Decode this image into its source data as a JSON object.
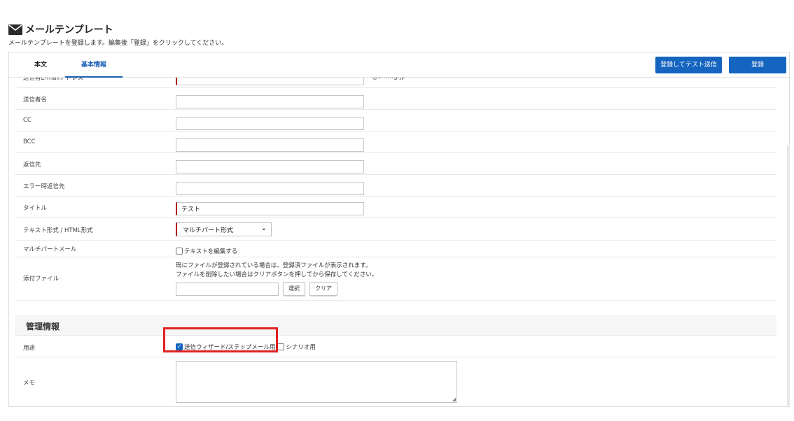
{
  "header": {
    "title": "メールテンプレート",
    "description": "メールテンプレートを登録します。編集後「登録」をクリックしてください。"
  },
  "tabs": [
    {
      "label": "本文"
    },
    {
      "label": "基本情報"
    }
  ],
  "toolbar": {
    "test_send_label": "登録してテスト送信",
    "save_label": "登録"
  },
  "form": {
    "sender_email": {
      "label": "送信者E-mailアドレス",
      "value": "",
      "domain": "@smktg.jp"
    },
    "sender_name": {
      "label": "送信者名",
      "value": ""
    },
    "cc": {
      "label": "CC",
      "value": ""
    },
    "bcc": {
      "label": "BCC",
      "value": ""
    },
    "reply_to": {
      "label": "返信先",
      "value": ""
    },
    "error_reply": {
      "label": "エラー時返信先",
      "value": ""
    },
    "title": {
      "label": "タイトル",
      "value": "テスト"
    },
    "format": {
      "label": "テキスト形式 / HTML形式",
      "selected": "マルチパート形式"
    },
    "multipart": {
      "label": "マルチパートメール",
      "checkbox_label": "テキストを編集する"
    },
    "attachment": {
      "label": "添付ファイル",
      "note_line1": "既にファイルが登録されている場合は、登録済ファイルが表示されます。",
      "note_line2": "ファイルを削除したい場合はクリアボタンを押してから保存してください。",
      "select_label": "選択",
      "clear_label": "クリア"
    }
  },
  "management": {
    "section_title": "管理情報",
    "usage": {
      "label": "用途",
      "option1": "送信ウィザード/ステップメール用",
      "option1_checked": true,
      "option2": "シナリオ用",
      "option2_checked": false
    },
    "memo": {
      "label": "メモ",
      "value": ""
    }
  },
  "colors": {
    "accent": "#1565c0",
    "required": "#b01c1c",
    "highlight": "#e02020"
  }
}
